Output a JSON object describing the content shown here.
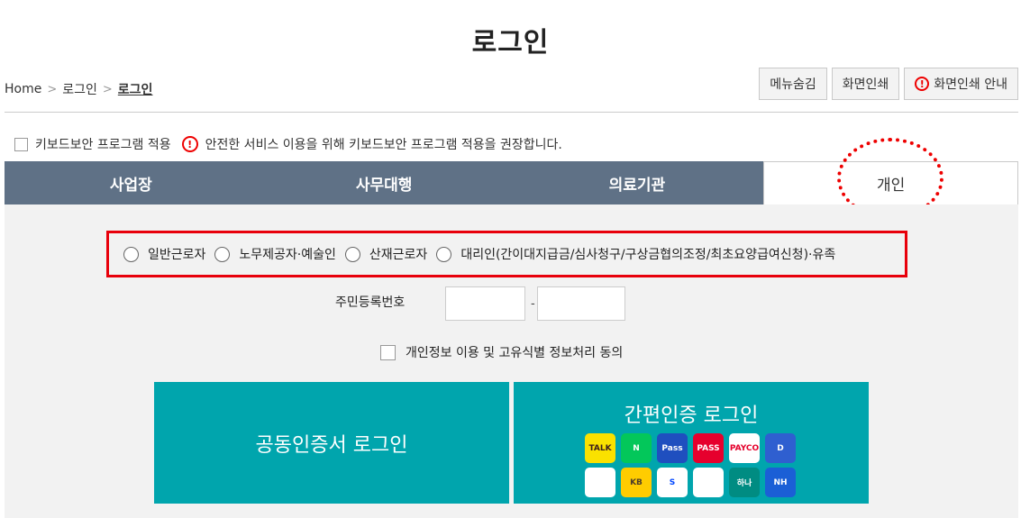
{
  "page": {
    "title": "로그인"
  },
  "breadcrumb": {
    "items": [
      "Home",
      "로그인"
    ],
    "current": "로그인"
  },
  "top_buttons": {
    "hide_menu": "메뉴숨김",
    "print": "화면인쇄",
    "print_guide": "화면인쇄 안내"
  },
  "keyboard_security": {
    "checkbox_label": "키보드보안 프로그램 적용",
    "notice": "안전한 서비스 이용을 위해 키보드보안 프로그램 적용을 권장합니다."
  },
  "tabs": [
    {
      "label": "사업장",
      "active": false
    },
    {
      "label": "사무대행",
      "active": false
    },
    {
      "label": "의료기관",
      "active": false
    },
    {
      "label": "개인",
      "active": true
    }
  ],
  "user_types": [
    "일반근로자",
    "노무제공자·예술인",
    "산재근로자",
    "대리인(간이대지급금/심사청구/구상금협의조정/최초요양급여신청)·유족"
  ],
  "rrn": {
    "label": "주민등록번호",
    "separator": "-",
    "first_value": "",
    "second_value": ""
  },
  "consent": {
    "label": "개인정보 이용 및 고유식별 정보처리 동의"
  },
  "cert_login": {
    "label": "공동인증서 로그인"
  },
  "simple_login": {
    "label": "간편인증 로그인",
    "providers": [
      {
        "icon": "kakao-icon",
        "text": "TALK",
        "bg": "#fae100",
        "fg": "#3a1d1d"
      },
      {
        "icon": "naver-icon",
        "text": "N",
        "bg": "#03c75a",
        "fg": "#ffffff"
      },
      {
        "icon": "samsung-pass-icon",
        "text": "Pass",
        "bg": "#1f4fbf",
        "fg": "#ffffff"
      },
      {
        "icon": "pass-icon",
        "text": "PASS",
        "bg": "#e6002d",
        "fg": "#ffffff"
      },
      {
        "icon": "payco-icon",
        "text": "PAYCO",
        "bg": "#ffffff",
        "fg": "#e4002b"
      },
      {
        "icon": "dream-icon",
        "text": "D",
        "bg": "#2f5fd0",
        "fg": "#ffffff"
      },
      {
        "icon": "toss-icon",
        "text": "",
        "bg": "#ffffff",
        "fg": "#1a75f0"
      },
      {
        "icon": "kb-bank-icon",
        "text": "KB",
        "bg": "#ffcc00",
        "fg": "#4b3c2a"
      },
      {
        "icon": "shinhan-bank-icon",
        "text": "S",
        "bg": "#ffffff",
        "fg": "#0046ff"
      },
      {
        "icon": "banksalad-icon",
        "text": "",
        "bg": "#ffffff",
        "fg": "#00c389"
      },
      {
        "icon": "hana-bank-icon",
        "text": "하나",
        "bg": "#008c82",
        "fg": "#ffffff"
      },
      {
        "icon": "nh-bank-icon",
        "text": "NH",
        "bg": "#1b5fd6",
        "fg": "#ffffff"
      }
    ]
  }
}
